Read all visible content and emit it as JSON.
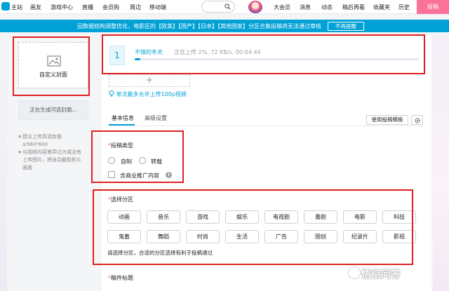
{
  "topnav": {
    "items": [
      "主站",
      "画友",
      "游戏中心",
      "直播",
      "会员购",
      "周边",
      "移动端"
    ],
    "right_items": [
      "大会员",
      "消息",
      "动态",
      "稿后再看",
      "收藏夹",
      "历史"
    ],
    "upload_label": "投稿"
  },
  "notice": {
    "text": "因数据结构调整优化，电影区的【欧美】【国产】【日本】【其他国家】分区合集投稿将无法通过审核",
    "button": "不再提醒"
  },
  "cover": {
    "label": "自定义封面",
    "generating": "正在生成可选封面...",
    "tips": [
      "建议上传高清封面≥960*600",
      "与视频内容差异过大或没有上传图片，将自动截取影片画面"
    ]
  },
  "upload": {
    "index": "1",
    "file_name": "不错的冬天",
    "status": "正在上传 2%, 72 KB/s, 00:04:44",
    "progress": 0.02,
    "add_symbol": "+",
    "hint": "单次最多允许上传100p视频"
  },
  "tabs": [
    "基本信息",
    "高级设置"
  ],
  "template_label": "使用投稿模板",
  "post_type": {
    "required_mark": "*",
    "title": "投稿类型",
    "options": [
      "自制",
      "转载"
    ],
    "commercial": "含商业推广内容"
  },
  "zones": {
    "required_mark": "*",
    "title": "选择分区",
    "row1": [
      "动画",
      "音乐",
      "游戏",
      "娱乐",
      "电视剧",
      "番剧",
      "电影",
      "科技"
    ],
    "row2": [
      "鬼畜",
      "舞蹈",
      "时尚",
      "生活",
      "广告",
      "国创",
      "纪录片",
      "影视"
    ],
    "hint": "请选择分区，合适的分区选择有利于投稿通过"
  },
  "title_field": {
    "required_mark": "*",
    "label": "稿件标题"
  },
  "watermark": "悟空问答",
  "colors": {
    "accent": "#00a1d6",
    "pink": "#fb7299",
    "highlight": "#e02020"
  }
}
